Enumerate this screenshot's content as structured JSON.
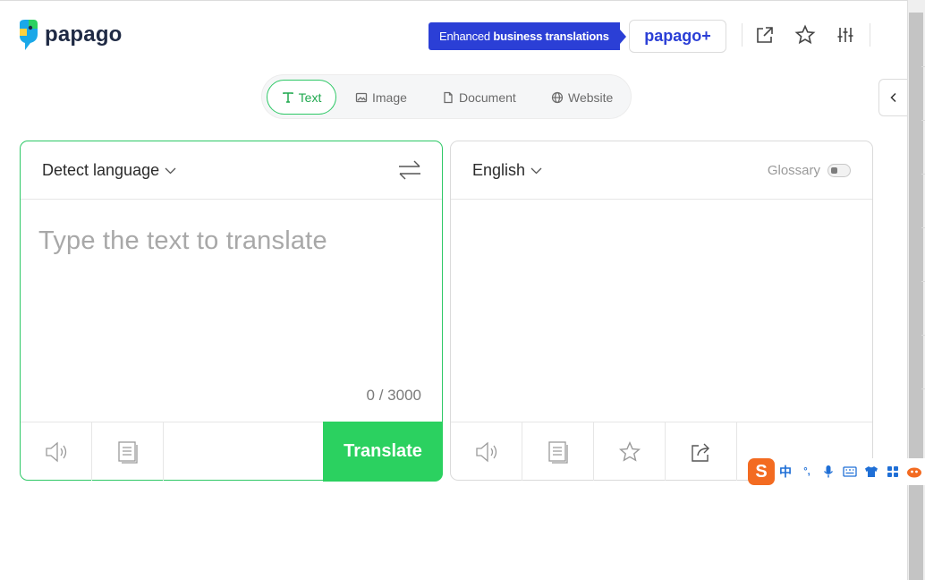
{
  "header": {
    "logo_text": "papago",
    "promo_prefix": "Enhanced ",
    "promo_bold": "business translations",
    "plus_label": "papago+",
    "icons": [
      "new-window-icon",
      "star-icon",
      "settings-sliders-icon"
    ]
  },
  "tabs": [
    {
      "label": "Text",
      "icon": "text-icon",
      "active": true
    },
    {
      "label": "Image",
      "icon": "image-icon",
      "active": false
    },
    {
      "label": "Document",
      "icon": "document-icon",
      "active": false
    },
    {
      "label": "Website",
      "icon": "globe-icon",
      "active": false
    }
  ],
  "source": {
    "language": "Detect language",
    "placeholder": "Type the text to translate",
    "counter": "0 / 3000",
    "translate_label": "Translate"
  },
  "target": {
    "language": "English",
    "glossary_label": "Glossary"
  },
  "colors": {
    "accent_green": "#2bd160",
    "brand_blue": "#2b3fd6"
  },
  "ime": {
    "logo": "S",
    "mode": "中",
    "punct": "°,"
  }
}
